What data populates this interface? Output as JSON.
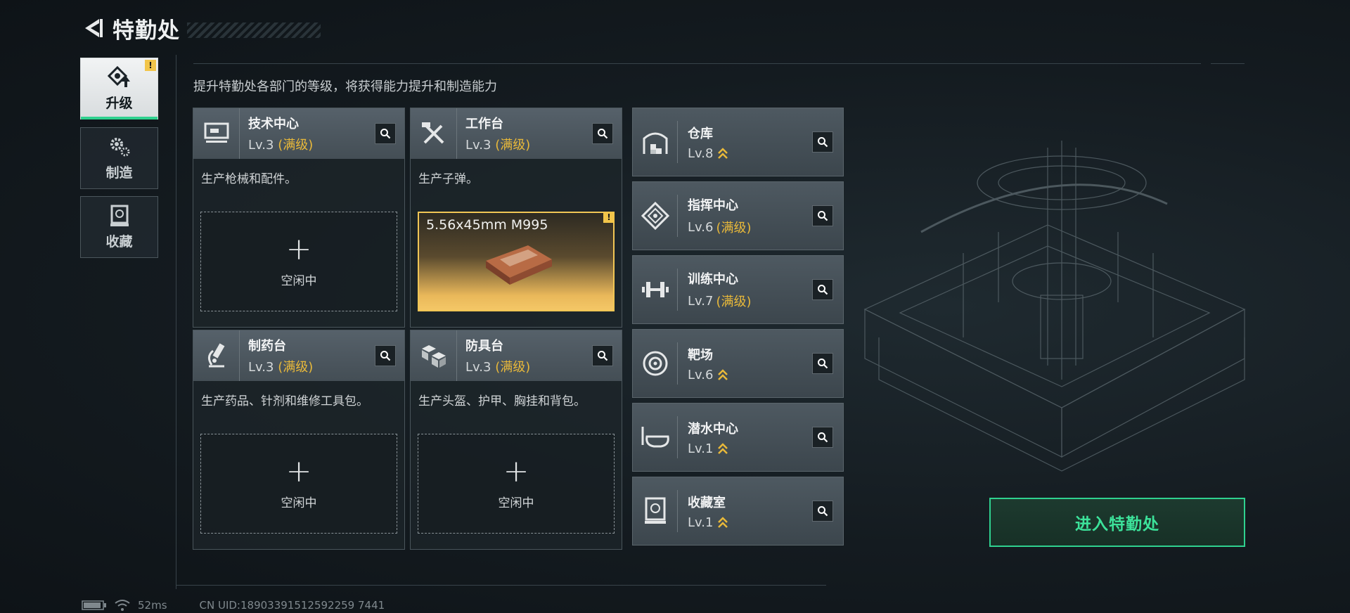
{
  "header": {
    "title": "特勤处"
  },
  "subtitle": "提升特勤处各部门的等级，将获得能力提升和制造能力",
  "side_tabs": [
    {
      "label": "升级",
      "icon": "upgrade-icon",
      "active": true,
      "alert": "!"
    },
    {
      "label": "制造",
      "icon": "gears-icon",
      "active": false
    },
    {
      "label": "收藏",
      "icon": "collection-icon",
      "active": false
    }
  ],
  "workshops": [
    {
      "name": "技术中心",
      "level": "Lv.3",
      "status": "(满级)",
      "desc": "生产枪械和配件。",
      "icon": "tech-center-icon",
      "slot": "空闲中"
    },
    {
      "name": "工作台",
      "level": "Lv.3",
      "status": "(满级)",
      "desc": "生产子弹。",
      "icon": "workbench-icon",
      "slot_item": "5.56x45mm M995",
      "alert": "!"
    },
    {
      "name": "制药台",
      "level": "Lv.3",
      "status": "(满级)",
      "desc": "生产药品、针剂和维修工具包。",
      "icon": "pharmacy-icon",
      "slot": "空闲中"
    },
    {
      "name": "防具台",
      "level": "Lv.3",
      "status": "(满级)",
      "desc": "生产头盔、护甲、胸挂和背包。",
      "icon": "armor-bench-icon",
      "slot": "空闲中"
    }
  ],
  "slot_plus": "+",
  "facilities": [
    {
      "name": "仓库",
      "level": "Lv.8",
      "status": "",
      "upgradable": true,
      "icon": "warehouse-icon"
    },
    {
      "name": "指挥中心",
      "level": "Lv.6",
      "status": "(满级)",
      "upgradable": false,
      "icon": "command-center-icon"
    },
    {
      "name": "训练中心",
      "level": "Lv.7",
      "status": "(满级)",
      "upgradable": false,
      "icon": "training-center-icon"
    },
    {
      "name": "靶场",
      "level": "Lv.6",
      "status": "",
      "upgradable": true,
      "icon": "shooting-range-icon"
    },
    {
      "name": "潜水中心",
      "level": "Lv.1",
      "status": "",
      "upgradable": true,
      "icon": "diving-center-icon"
    },
    {
      "name": "收藏室",
      "level": "Lv.1",
      "status": "",
      "upgradable": true,
      "icon": "collection-room-icon"
    }
  ],
  "enter_button": "进入特勤处",
  "status_bar": {
    "ping": "52ms",
    "uid": "CN UID:18903391512592259 7441"
  },
  "colors": {
    "accent_green": "#2fd18f",
    "max_gold": "#e9b93a",
    "alert_yellow": "#f2c54a"
  }
}
